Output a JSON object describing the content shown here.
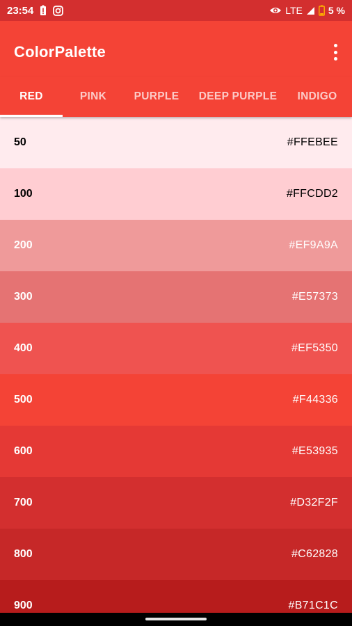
{
  "status_bar": {
    "time": "23:54",
    "network": "LTE",
    "battery": "5 %",
    "icons": [
      "battery-alert-icon",
      "instagram-icon",
      "eye-icon",
      "signal-icon",
      "battery-low-icon"
    ]
  },
  "app_bar": {
    "title": "ColorPalette",
    "menu_icon": "more-vert-icon"
  },
  "tabs": [
    {
      "label": "RED",
      "active": true
    },
    {
      "label": "PINK",
      "active": false
    },
    {
      "label": "PURPLE",
      "active": false
    },
    {
      "label": "DEEP PURPLE",
      "active": false
    },
    {
      "label": "INDIGO",
      "active": false
    }
  ],
  "swatches": [
    {
      "shade": "50",
      "hex": "#FFEBEE",
      "color": "#FFEBEE",
      "text_color": "#000000"
    },
    {
      "shade": "100",
      "hex": "#FFCDD2",
      "color": "#FFCDD2",
      "text_color": "#000000"
    },
    {
      "shade": "200",
      "hex": "#EF9A9A",
      "color": "#EF9A9A",
      "text_color": "#FFFFFF"
    },
    {
      "shade": "300",
      "hex": "#E57373",
      "color": "#E57373",
      "text_color": "#FFFFFF"
    },
    {
      "shade": "400",
      "hex": "#EF5350",
      "color": "#EF5350",
      "text_color": "#FFFFFF"
    },
    {
      "shade": "500",
      "hex": "#F44336",
      "color": "#F44336",
      "text_color": "#FFFFFF"
    },
    {
      "shade": "600",
      "hex": "#E53935",
      "color": "#E53935",
      "text_color": "#FFFFFF"
    },
    {
      "shade": "700",
      "hex": "#D32F2F",
      "color": "#D32F2F",
      "text_color": "#FFFFFF"
    },
    {
      "shade": "800",
      "hex": "#C62828",
      "color": "#C62828",
      "text_color": "#FFFFFF"
    },
    {
      "shade": "900",
      "hex": "#B71C1C",
      "color": "#B71C1C",
      "text_color": "#FFFFFF"
    }
  ],
  "colors": {
    "primary": "#F44336",
    "status_bar": "#D32F2F"
  }
}
